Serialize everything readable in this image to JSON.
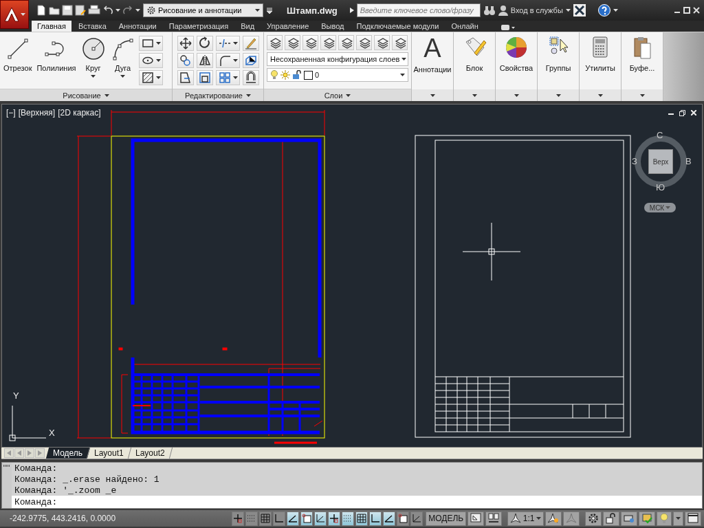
{
  "title_bar": {
    "workspace": "Рисование и аннотации",
    "file_name": "Штамп.dwg",
    "search": {
      "placeholder": "Введите ключевое слово/фразу"
    },
    "sign_in": "Вход в службы"
  },
  "ribbon_tabs": [
    {
      "label": "Главная",
      "selected": true
    },
    {
      "label": "Вставка",
      "selected": false
    },
    {
      "label": "Аннотации",
      "selected": false
    },
    {
      "label": "Параметризация",
      "selected": false
    },
    {
      "label": "Вид",
      "selected": false
    },
    {
      "label": "Управление",
      "selected": false
    },
    {
      "label": "Вывод",
      "selected": false
    },
    {
      "label": "Подключаемые модули",
      "selected": false
    },
    {
      "label": "Онлайн",
      "selected": false
    }
  ],
  "draw_panel": {
    "title": "Рисование",
    "tools": [
      {
        "label": "Отрезок",
        "has_menu": false
      },
      {
        "label": "Полилиния",
        "has_menu": false
      },
      {
        "label": "Круг",
        "has_menu": true
      },
      {
        "label": "Дуга",
        "has_menu": true
      }
    ]
  },
  "modify_panel": {
    "title": "Редактирование"
  },
  "layers_panel": {
    "title": "Слои",
    "layer_state": "Несохраненная конфигурация слоев",
    "current_layer": "0"
  },
  "large_panels": [
    {
      "label": "Аннотации",
      "glyph": "A"
    },
    {
      "label": "Блок"
    },
    {
      "label": "Свойства"
    },
    {
      "label": "Группы"
    },
    {
      "label": "Утилиты"
    },
    {
      "label": "Буфе..."
    }
  ],
  "viewport": {
    "controls": [
      "[−]",
      "[Верхняя]",
      "[2D каркас]"
    ],
    "viewcube": {
      "north": "С",
      "east": "В",
      "south": "Ю",
      "west": "З",
      "face": "Верх",
      "ucs": "МСК"
    },
    "axis_y": "Y",
    "axis_x": "X"
  },
  "layout_tabs": [
    {
      "label": "Модель",
      "selected": true
    },
    {
      "label": "Layout1",
      "selected": false
    },
    {
      "label": "Layout2",
      "selected": false
    }
  ],
  "command_history": [
    "Команда:",
    "Команда: _.erase найдено: 1",
    "Команда: '_.zoom _e"
  ],
  "command_prompt": "Команда:",
  "status_bar": {
    "coordinates": "-242.9775, 443.2416, 0.0000",
    "toggles": [
      {
        "on": false
      },
      {
        "on": false
      },
      {
        "on": false
      },
      {
        "on": false
      },
      {
        "on": true
      },
      {
        "on": true
      },
      {
        "on": true
      },
      {
        "on": true
      },
      {
        "on": true
      },
      {
        "on": true
      },
      {
        "on": true
      },
      {
        "on": true
      },
      {
        "on": false
      },
      {
        "on": false
      }
    ],
    "space": "МОДЕЛЬ",
    "annotation_scale": "1:1"
  }
}
